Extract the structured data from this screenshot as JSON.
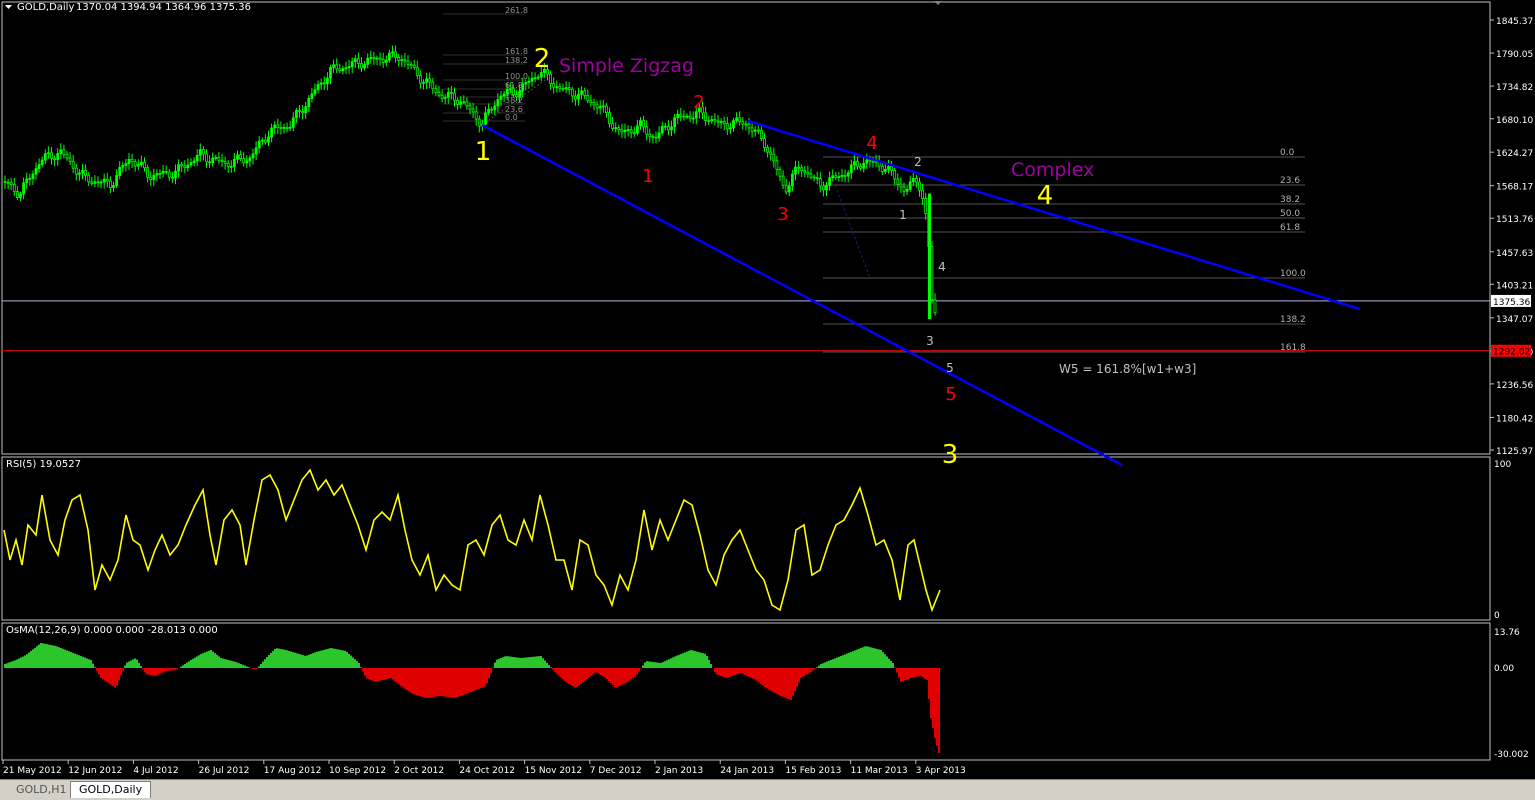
{
  "window": {
    "symbol_label": "GOLD,Daily",
    "ohlc": "1370.04 1394.94 1364.96 1375.36"
  },
  "colors": {
    "background": "#000000",
    "bull_candle": "#00ff00",
    "channel": "#0000ff",
    "rsi_line": "#ffff00",
    "osma_positive": "#2cc62c",
    "osma_negative": "#e00000",
    "support_line": "#ff0000",
    "price_line": "#b4b4e6",
    "text_grey": "#c0c0c0",
    "label_yellow": "#ffff00",
    "label_red": "#ff0000",
    "label_purple": "#a000a0"
  },
  "tabs": [
    {
      "label": "GOLD,H1",
      "active": false
    },
    {
      "label": "GOLD,Daily",
      "active": true
    }
  ],
  "main_panel": {
    "price_axis_ticks": [
      "1845.37",
      "1790.05",
      "1734.82",
      "1680.10",
      "1624.27",
      "1568.17",
      "1513.76",
      "1457.63",
      "1403.21",
      "1347.07",
      "1291.70",
      "1236.56",
      "1180.42",
      "1125.97"
    ],
    "current_price_tag": "1375.36",
    "red_line_tag": "1292.02",
    "annotations": {
      "simple_zigzag": "Simple Zigzag",
      "complex": "Complex",
      "formula": "W5 = 161.8%[w1+w3]"
    },
    "wave_labels_yellow": [
      "1",
      "2",
      "3",
      "4"
    ],
    "wave_labels_red": [
      "1",
      "2",
      "3",
      "4",
      "5"
    ],
    "wave_labels_grey": [
      "1",
      "2",
      "3",
      "4",
      "5"
    ],
    "fib_left_levels": [
      "261.8",
      "161.8",
      "138.2",
      "100.0",
      "61.8",
      "50.0",
      "38.2",
      "23.6",
      "0.0"
    ],
    "fib_right_levels": [
      "0.0",
      "23.6",
      "38.2",
      "50.0",
      "61.8",
      "100.0",
      "138.2",
      "161.8"
    ]
  },
  "rsi_panel": {
    "title": "RSI(5) 19.0527",
    "axis_ticks": [
      "100",
      "0"
    ]
  },
  "osma_panel": {
    "title": "OsMA(12,26,9) 0.000 0.000 -28.013 0.000",
    "axis_ticks": [
      "13.76",
      "0.00",
      "-30.002"
    ]
  },
  "date_axis": [
    "21 May 2012",
    "12 Jun 2012",
    "4 Jul 2012",
    "26 Jul 2012",
    "17 Aug 2012",
    "10 Sep 2012",
    "2 Oct 2012",
    "24 Oct 2012",
    "15 Nov 2012",
    "7 Dec 2012",
    "2 Jan 2013",
    "24 Jan 2013",
    "15 Feb 2013",
    "11 Mar 2013",
    "3 Apr 2013"
  ],
  "chart_data": {
    "type": "candlestick",
    "symbol": "GOLD",
    "timeframe": "Daily",
    "last_ohlc": {
      "open": 1370.04,
      "high": 1394.94,
      "low": 1364.96,
      "close": 1375.36
    },
    "x": [
      "21 May 2012",
      "12 Jun 2012",
      "4 Jul 2012",
      "26 Jul 2012",
      "17 Aug 2012",
      "10 Sep 2012",
      "2 Oct 2012",
      "24 Oct 2012",
      "15 Nov 2012",
      "7 Dec 2012",
      "2 Jan 2013",
      "24 Jan 2013",
      "15 Feb 2013",
      "11 Mar 2013",
      "3 Apr 2013"
    ],
    "close_approx": [
      1570,
      1615,
      1580,
      1605,
      1620,
      1740,
      1775,
      1705,
      1725,
      1705,
      1665,
      1680,
      1590,
      1600,
      1375
    ],
    "rsi_approx": [
      62,
      45,
      48,
      70,
      92,
      88,
      80,
      32,
      76,
      20,
      45,
      70,
      12,
      84,
      19
    ],
    "osma_approx": [
      8,
      5,
      -4,
      2,
      3,
      5,
      -3,
      -7,
      4,
      -3,
      3,
      4,
      -4,
      6,
      -28
    ],
    "ylim": [
      1125.97,
      1845.37
    ],
    "rsi_ylim": [
      0,
      100
    ],
    "osma_ylim": [
      -30.002,
      13.76
    ],
    "horizontal_lines": {
      "current_price": 1375.36,
      "red_support": 1292.02
    }
  }
}
